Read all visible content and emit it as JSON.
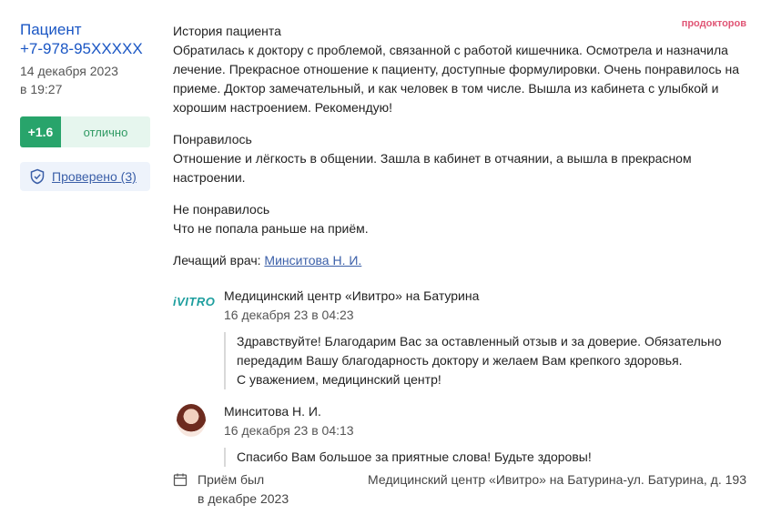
{
  "brand": "продокторов",
  "patient": {
    "name": "Пациент",
    "phone": "+7-978-95XXXXX",
    "date": "14 декабря 2023",
    "time": "в 19:27"
  },
  "score": {
    "value": "+1.6",
    "label": "отлично"
  },
  "verified": {
    "label": "Проверено (3)"
  },
  "review": {
    "history_title": "История пациента",
    "history_text": "Обратилась к доктору с проблемой, связанной с работой кишечника. Осмотрела и назначила лечение. Прекрасное отношение к пациенту, доступные формулировки. Очень понравилось на приеме. Доктор замечательный, и как человек в том числе. Вышла из кабинета с улыбкой и хорошим настроением. Рекомендую!",
    "liked_title": "Понравилось",
    "liked_text": "Отношение и лёгкость в общении. Зашла в кабинет в отчаянии, а вышла в прекрасном настроении.",
    "disliked_title": "Не понравилось",
    "disliked_text": "Что не попала раньше на приём.",
    "doctor_label": "Лечащий врач:",
    "doctor_name": "Минситова Н. И."
  },
  "replies": [
    {
      "logo": "iVITRO",
      "author": "Медицинский центр «Ивитро» на Батурина",
      "date": "16 декабря 23 в 04:23",
      "text_1": "Здравствуйте! Благодарим Вас за оставленный отзыв и за доверие. Обязательно передадим Вашу благодарность доктору и желаем Вам крепкого здоровья.",
      "text_2": "С уважением, медицинский центр!"
    },
    {
      "author": "Минситова Н. И.",
      "date": "16 декабря 23 в 04:13",
      "text_1": "Спасибо Вам большое за приятные слова! Будьте здоровы!"
    }
  ],
  "footer": {
    "visit_line1": "Приём был",
    "visit_line2": "в декабре 2023",
    "clinic": "Медицинский центр «Ивитро» на Батурина-ул. Батурина, д. 193"
  }
}
